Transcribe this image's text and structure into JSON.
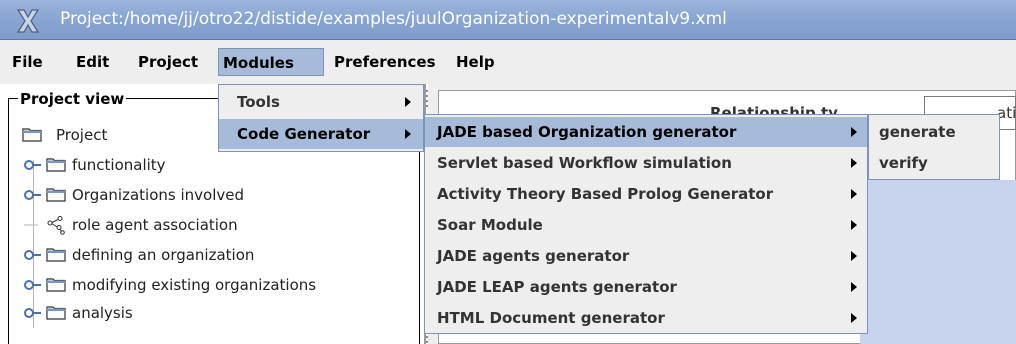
{
  "window": {
    "title": "Project:/home/jj/otro22/distide/examples/juulOrganization-experimentalv9.xml"
  },
  "menubar": {
    "items": [
      "File",
      "Edit",
      "Project",
      "Modules",
      "Preferences",
      "Help"
    ],
    "active": "Modules"
  },
  "project_view": {
    "legend": "Project view",
    "root": "Project",
    "items": [
      {
        "label": "functionality",
        "icon": "folder-icon",
        "expandable": true
      },
      {
        "label": "Organizations involved",
        "icon": "folder-icon",
        "expandable": true
      },
      {
        "label": "role agent association",
        "icon": "relationship-icon",
        "expandable": false
      },
      {
        "label": "defining an organization",
        "icon": "folder-icon",
        "expandable": true
      },
      {
        "label": "modifying existing organizations",
        "icon": "folder-icon",
        "expandable": true
      },
      {
        "label": "analysis",
        "icon": "folder-icon",
        "expandable": true
      }
    ]
  },
  "editor": {
    "partial_label": "Relationship ty",
    "partial_field": "ati"
  },
  "modules_menu": {
    "items": [
      "Tools",
      "Code Generator"
    ],
    "highlighted": "Code Generator"
  },
  "code_generator_menu": {
    "items": [
      "JADE based Organization generator",
      "Servlet based Workflow simulation",
      "Activity Theory Based Prolog Generator",
      "Soar Module",
      "JADE agents generator",
      "JADE LEAP agents generator",
      "HTML Document generator"
    ],
    "highlighted": "JADE based Organization generator"
  },
  "jade_org_menu": {
    "items": [
      "generate",
      "verify"
    ]
  },
  "colors": {
    "title_bar": "#8aa6d2",
    "menu_highlight": "#a6bbd9",
    "menu_background": "#eeeeee",
    "canvas": "#c8d4ee"
  }
}
